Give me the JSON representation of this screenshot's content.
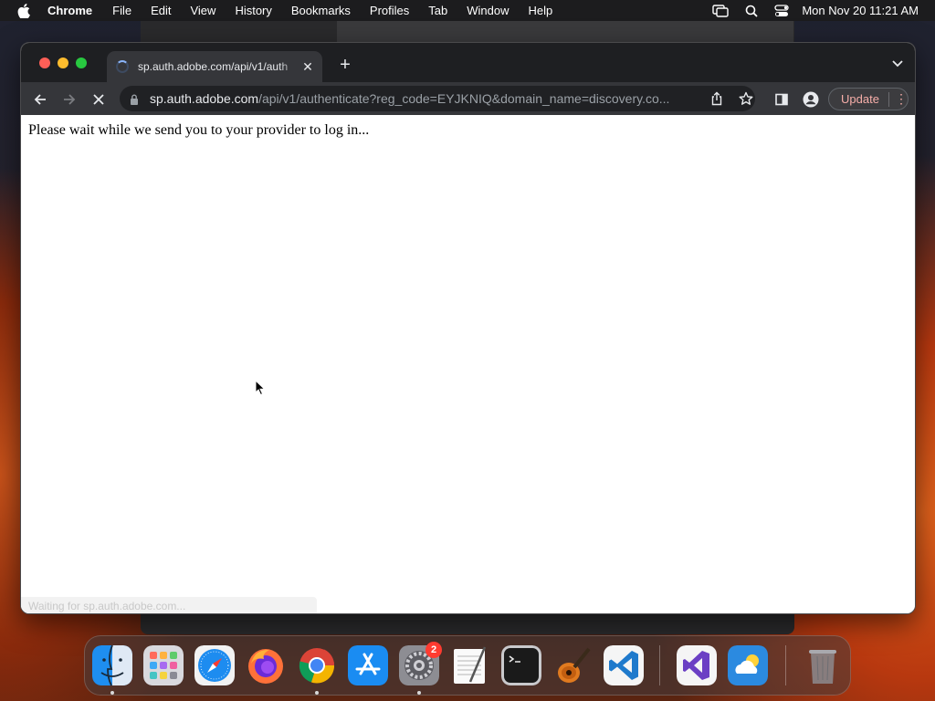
{
  "menubar": {
    "app_name": "Chrome",
    "items": [
      "File",
      "Edit",
      "View",
      "History",
      "Bookmarks",
      "Profiles",
      "Tab",
      "Window",
      "Help"
    ],
    "clock": "Mon Nov 20  11:21 AM"
  },
  "browser": {
    "tab_title": "sp.auth.adobe.com/api/v1/auth",
    "url_host": "sp.auth.adobe.com",
    "url_path": "/api/v1/authenticate?reg_code=EYJKNIQ&domain_name=discovery.co...",
    "update_label": "Update",
    "menu_glyph": "⋮",
    "new_tab_glyph": "+",
    "close_glyph": "✕"
  },
  "page": {
    "message": "Please wait while we send you to your provider to log in...",
    "status_url": "Waiting for sp.auth.adobe.com..."
  },
  "dock": {
    "apps": [
      "finder",
      "launchpad",
      "safari",
      "firefox",
      "chrome",
      "app-store",
      "system-settings",
      "textedit",
      "terminal",
      "garageband",
      "vscode",
      "visual-studio",
      "weather",
      "trash"
    ],
    "settings_badge": "2"
  },
  "colors": {
    "accent_blue": "#8ab4f8",
    "update_text": "#f6aea9",
    "traffic_red": "#ff5f57",
    "traffic_yellow": "#febc2e",
    "traffic_green": "#28c840"
  }
}
